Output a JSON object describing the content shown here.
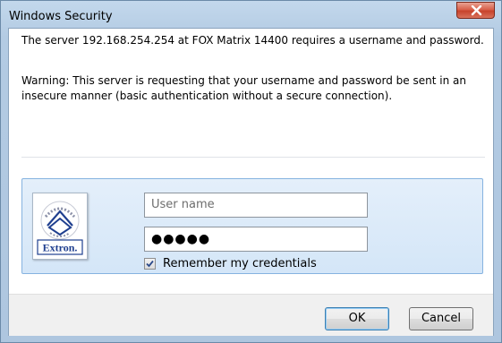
{
  "window": {
    "title": "Windows Security"
  },
  "message": {
    "line1": "The server 192.168.254.254 at FOX Matrix 14400 requires a username and password.",
    "line2": "Warning: This server is requesting that your username and password be sent in an insecure manner (basic authentication without a secure connection)."
  },
  "credentials": {
    "tile_logo_text": "Extron.",
    "username_placeholder": "User name",
    "password_masked": "●●●●●",
    "remember_label": "Remember my credentials",
    "remember_checked": true
  },
  "buttons": {
    "ok": "OK",
    "cancel": "Cancel"
  },
  "colors": {
    "close_button": "#c7432c",
    "panel_border": "#86b3e0",
    "logo_blue": "#1f3f8f"
  }
}
